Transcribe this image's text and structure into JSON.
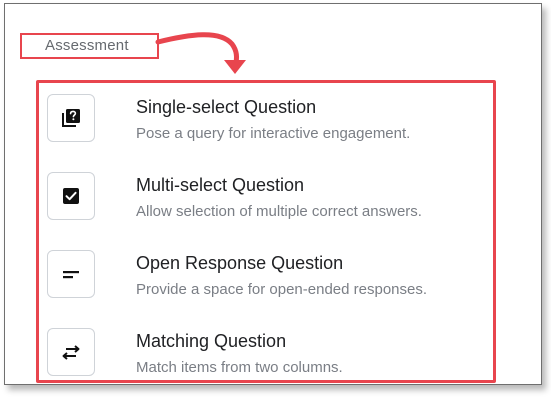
{
  "section": {
    "label": "Assessment"
  },
  "options": [
    {
      "title": "Single-select Question",
      "description": "Pose a query for interactive engagement.",
      "icon": "quiz-question-icon"
    },
    {
      "title": "Multi-select Question",
      "description": "Allow selection of multiple correct answers.",
      "icon": "checkbox-checked-icon"
    },
    {
      "title": "Open Response Question",
      "description": "Provide a space for open-ended responses.",
      "icon": "short-text-icon"
    },
    {
      "title": "Matching Question",
      "description": "Match items from two columns.",
      "icon": "swap-arrows-icon"
    }
  ],
  "colors": {
    "highlight": "#e8454e",
    "title_text": "#202124",
    "description_text": "#7a7e85",
    "label_text": "#666a6f"
  }
}
